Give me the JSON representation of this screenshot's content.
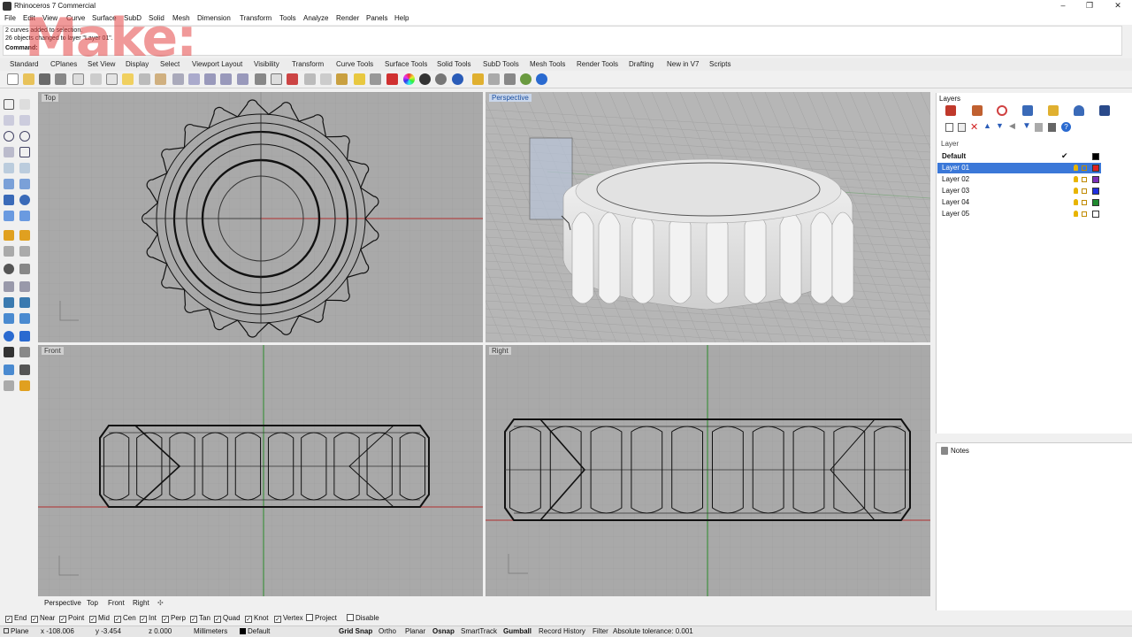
{
  "window": {
    "title": "Rhinoceros 7 Commercial"
  },
  "watermark": "Make:",
  "menu": [
    "File",
    "Edit",
    "View",
    "Curve",
    "Surface",
    "SubD",
    "Solid",
    "Mesh",
    "Dimension",
    "Transform",
    "Tools",
    "Analyze",
    "Render",
    "Panels",
    "Help"
  ],
  "command": {
    "history": [
      "2 curves added to selection.",
      "26 objects changed to layer \"Layer 01\"."
    ],
    "prompt": "Command:",
    "value": ""
  },
  "toolbar_tabs": [
    "Standard",
    "CPlanes",
    "Set View",
    "Display",
    "Select",
    "Viewport Layout",
    "Visibility",
    "Transform",
    "Curve Tools",
    "Surface Tools",
    "Solid Tools",
    "SubD Tools",
    "Mesh Tools",
    "Render Tools",
    "Drafting",
    "New in V7",
    "Scripts"
  ],
  "viewports": {
    "top": "Top",
    "perspective": "Perspective",
    "front": "Front",
    "right": "Right"
  },
  "viewport_tabs": [
    "Perspective",
    "Top",
    "Front",
    "Right"
  ],
  "layers": {
    "title": "Layers",
    "header": "Layer",
    "rows": [
      {
        "name": "Default",
        "color": "#000000",
        "current": true
      },
      {
        "name": "Layer 01",
        "color": "#e02020",
        "selected": true
      },
      {
        "name": "Layer 02",
        "color": "#7a2fb8"
      },
      {
        "name": "Layer 03",
        "color": "#1f2fe0"
      },
      {
        "name": "Layer 04",
        "color": "#1f8a2f"
      },
      {
        "name": "Layer 05",
        "color": "#ffffff"
      }
    ]
  },
  "notes": {
    "title": "Notes"
  },
  "osnaps": [
    {
      "label": "End",
      "checked": true
    },
    {
      "label": "Near",
      "checked": true
    },
    {
      "label": "Point",
      "checked": true
    },
    {
      "label": "Mid",
      "checked": true
    },
    {
      "label": "Cen",
      "checked": true
    },
    {
      "label": "Int",
      "checked": true
    },
    {
      "label": "Perp",
      "checked": true
    },
    {
      "label": "Tan",
      "checked": true
    },
    {
      "label": "Quad",
      "checked": true
    },
    {
      "label": "Knot",
      "checked": true
    },
    {
      "label": "Vertex",
      "checked": true
    },
    {
      "label": "Project",
      "checked": false
    },
    {
      "label": "Disable",
      "checked": false
    }
  ],
  "status": {
    "cplane": "Plane",
    "x": "x -108.006",
    "y": "y -3.454",
    "z": "z 0.000",
    "units": "Millimeters",
    "layer": "Default",
    "grid_snap": "Grid Snap",
    "ortho": "Ortho",
    "planar": "Planar",
    "osnap": "Osnap",
    "smarttrack": "SmartTrack",
    "gumball": "Gumball",
    "record": "Record History",
    "filter": "Filter",
    "tolerance": "Absolute tolerance: 0.001"
  },
  "colors": {
    "accent": "#3b78d8",
    "viewport_bg": "#a9a9a9"
  }
}
